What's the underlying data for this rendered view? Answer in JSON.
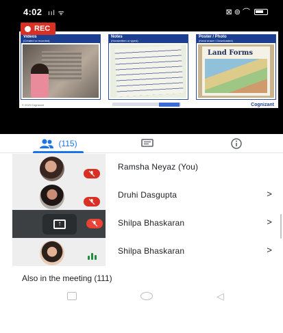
{
  "status_bar": {
    "time": "4:02",
    "signal": "ııl",
    "network": "ᯤ",
    "right_icons": "⊠ ⊚ ⌒"
  },
  "recording": {
    "label": "REC",
    "color": "#d93025"
  },
  "presentation": {
    "panels": [
      {
        "title": "Videos",
        "subtitle": "(Created or recorded)"
      },
      {
        "title": "Notes",
        "subtitle": "(Handwritten or typed)"
      },
      {
        "title": "Poster / Photo",
        "subtitle": "(Hand drawn / Downloaded)"
      }
    ],
    "poster_text": "Land Forms",
    "footer_left": "© 2020 Cognizant",
    "brand": "Cognizant"
  },
  "tabs": {
    "people_count": "(115)",
    "people_icon": "people-icon",
    "chat_icon": "chat-icon",
    "info_icon": "info-icon",
    "accent": "#1a73e8"
  },
  "participants": [
    {
      "name": "Ramsha Neyaz (You)",
      "state": "muted",
      "chevron": ""
    },
    {
      "name": "Druhi Dasgupta",
      "state": "muted",
      "chevron": ">"
    },
    {
      "name": "Shilpa Bhaskaran",
      "state": "presenting-muted",
      "chevron": ">"
    },
    {
      "name": "Shilpa Bhaskaran",
      "state": "speaking",
      "chevron": ">"
    }
  ],
  "also_in_meeting": "Also in the meeting (111)",
  "nav": {
    "recent": "recent-apps-icon",
    "home": "home-icon",
    "back": "◁"
  },
  "colors": {
    "mute": "#d93025",
    "speaking": "#1e8e3e"
  }
}
